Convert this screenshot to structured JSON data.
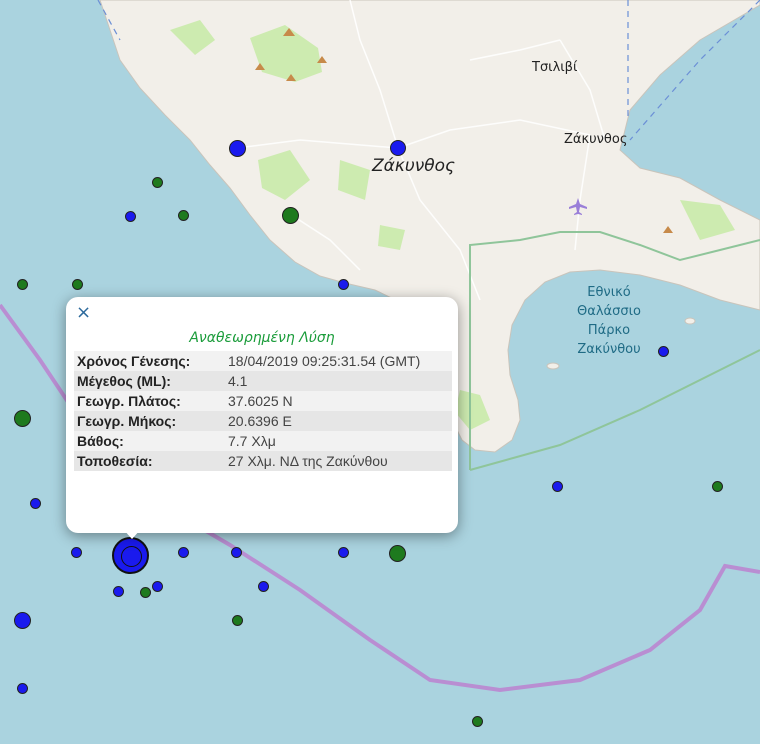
{
  "map": {
    "places": {
      "tsilivi": "Τσιλιβί",
      "zakynthos_town": "Ζάκυνθος",
      "zakynthos_city": "Ζάκυνθος",
      "park_line1": "Εθνικό",
      "park_line2": "Θαλάσσιο",
      "park_line3": "Πάρκο",
      "park_line4": "Ζακύνθου"
    },
    "colors": {
      "sea": "#aad3df",
      "land": "#f2efe9",
      "forest": "#cdebb0",
      "park_boundary": "#8fc59a",
      "plate_boundary": "#b98ed2",
      "quake_blue": "#1a1aee",
      "quake_green": "#1e7a1e"
    },
    "icons": {
      "airport": "airport-icon",
      "peak": "peak-icon",
      "close": "close-icon"
    }
  },
  "popup": {
    "close_symbol": "×",
    "title": "Αναθεωρημένη Λύση",
    "rows": [
      {
        "label": "Χρόνος Γένεσης:",
        "value": "18/04/2019 09:25:31.54 (GMT)"
      },
      {
        "label": "Μέγεθος (ML):",
        "value": "4.1"
      },
      {
        "label": "Γεωγρ. Πλάτος:",
        "value": "37.6025 N"
      },
      {
        "label": "Γεωγρ. Μήκος:",
        "value": "20.6396 E"
      },
      {
        "label": "Βάθος:",
        "value": "7.7 Χλμ"
      },
      {
        "label": "Τοποθεσία:",
        "value": "27 Χλμ. ΝΔ της Ζακύνθου"
      }
    ]
  }
}
